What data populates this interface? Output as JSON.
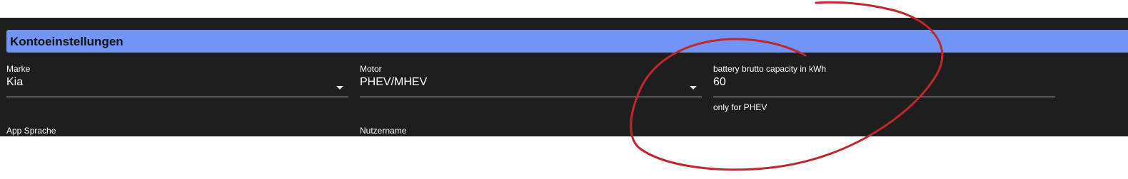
{
  "section": {
    "title": "Kontoeinstellungen"
  },
  "fields": {
    "marke": {
      "label": "Marke",
      "value": "Kia"
    },
    "motor": {
      "label": "Motor",
      "value": "PHEV/MHEV"
    },
    "battery": {
      "label": "battery brutto capacity in kWh",
      "value": "60",
      "helper": "only for PHEV"
    },
    "app_sprache": {
      "label": "App Sprache"
    },
    "nutzername": {
      "label": "Nutzername"
    }
  },
  "colors": {
    "panel_background": "#1e1e1e",
    "section_header": "#7294f7",
    "annotation_stroke": "#c0272d"
  }
}
